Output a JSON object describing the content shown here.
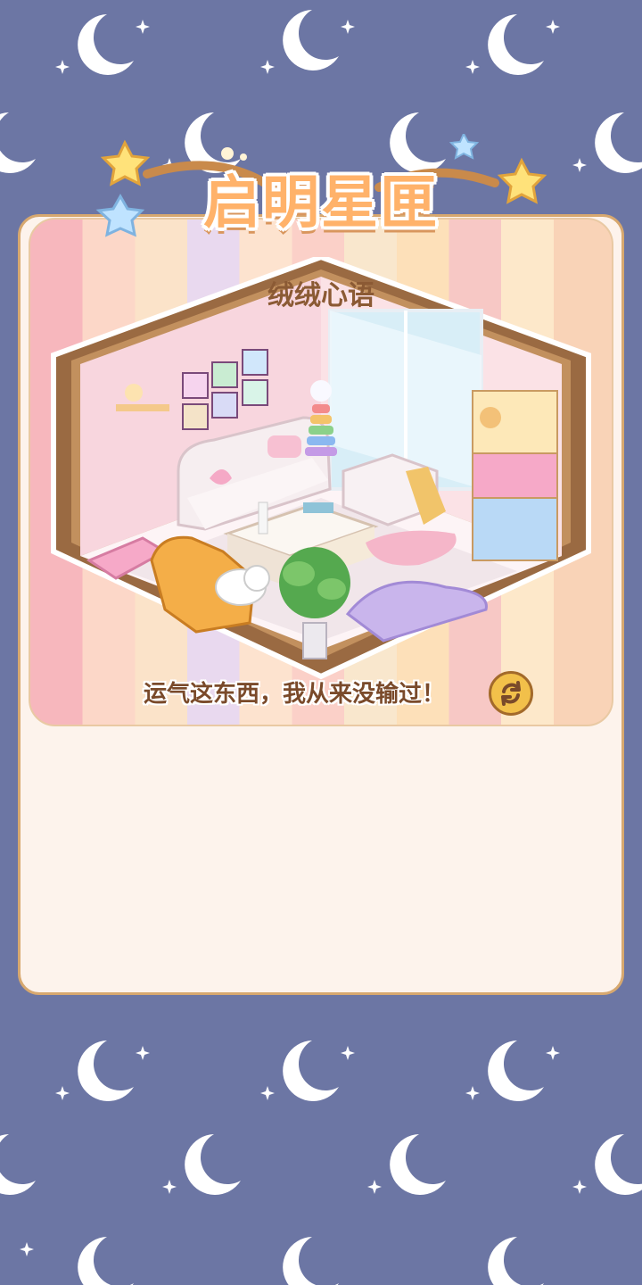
{
  "header": {
    "title": "启明星匣"
  },
  "room": {
    "name": "绒绒心语"
  },
  "quote": {
    "text": "运气这东西，我从来没输过！"
  },
  "buttons": {
    "refresh_icon": "refresh-icon"
  },
  "colors": {
    "background": "#6c76a4",
    "panel": "#fdf3ec",
    "title": "#ffb26a",
    "accent_gold": "#f2c04a"
  }
}
